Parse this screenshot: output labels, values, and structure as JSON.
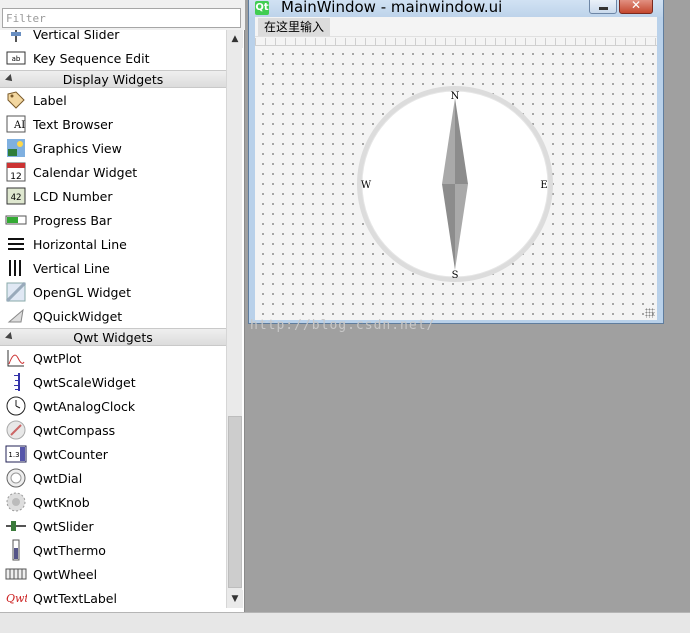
{
  "widget_box": {
    "filter_placeholder": "Filter",
    "rows": [
      {
        "type": "item",
        "label": "Vertical Slider",
        "icon": "vertical-slider-icon"
      },
      {
        "type": "item",
        "label": "Key Sequence Edit",
        "icon": "key-sequence-edit-icon"
      },
      {
        "type": "category",
        "label": "Display Widgets"
      },
      {
        "type": "item",
        "label": "Label",
        "icon": "label-icon"
      },
      {
        "type": "item",
        "label": "Text Browser",
        "icon": "text-browser-icon"
      },
      {
        "type": "item",
        "label": "Graphics View",
        "icon": "graphics-view-icon"
      },
      {
        "type": "item",
        "label": "Calendar Widget",
        "icon": "calendar-widget-icon"
      },
      {
        "type": "item",
        "label": "LCD Number",
        "icon": "lcd-number-icon"
      },
      {
        "type": "item",
        "label": "Progress Bar",
        "icon": "progress-bar-icon"
      },
      {
        "type": "item",
        "label": "Horizontal Line",
        "icon": "horizontal-line-icon"
      },
      {
        "type": "item",
        "label": "Vertical Line",
        "icon": "vertical-line-icon"
      },
      {
        "type": "item",
        "label": "OpenGL Widget",
        "icon": "opengl-widget-icon"
      },
      {
        "type": "item",
        "label": "QQuickWidget",
        "icon": "qquickwidget-icon"
      },
      {
        "type": "category",
        "label": "Qwt Widgets"
      },
      {
        "type": "item",
        "label": "QwtPlot",
        "icon": "qwt-plot-icon"
      },
      {
        "type": "item",
        "label": "QwtScaleWidget",
        "icon": "qwt-scale-widget-icon"
      },
      {
        "type": "item",
        "label": "QwtAnalogClock",
        "icon": "qwt-analog-clock-icon"
      },
      {
        "type": "item",
        "label": "QwtCompass",
        "icon": "qwt-compass-icon"
      },
      {
        "type": "item",
        "label": "QwtCounter",
        "icon": "qwt-counter-icon"
      },
      {
        "type": "item",
        "label": "QwtDial",
        "icon": "qwt-dial-icon"
      },
      {
        "type": "item",
        "label": "QwtKnob",
        "icon": "qwt-knob-icon"
      },
      {
        "type": "item",
        "label": "QwtSlider",
        "icon": "qwt-slider-icon"
      },
      {
        "type": "item",
        "label": "QwtThermo",
        "icon": "qwt-thermo-icon"
      },
      {
        "type": "item",
        "label": "QwtWheel",
        "icon": "qwt-wheel-icon"
      },
      {
        "type": "item",
        "label": "QwtTextLabel",
        "icon": "qwt-text-label-icon"
      }
    ]
  },
  "designer_window": {
    "title": "MainWindow - mainwindow.ui",
    "app_icon": "qt-designer-icon",
    "app_icon_glyph": "Qt",
    "menu_item": "在这里输入",
    "compass": {
      "labels": {
        "north": "N",
        "south": "S",
        "east": "E",
        "west": "W"
      },
      "needle_direction_deg": 0
    }
  },
  "watermark": "http://blog.csdn.net/",
  "colors": {
    "panel_bg": "#ffffff",
    "desktop_bg": "#a0a0a0",
    "titlebar": "#bdd3ea",
    "close_button": "#c4482f"
  }
}
